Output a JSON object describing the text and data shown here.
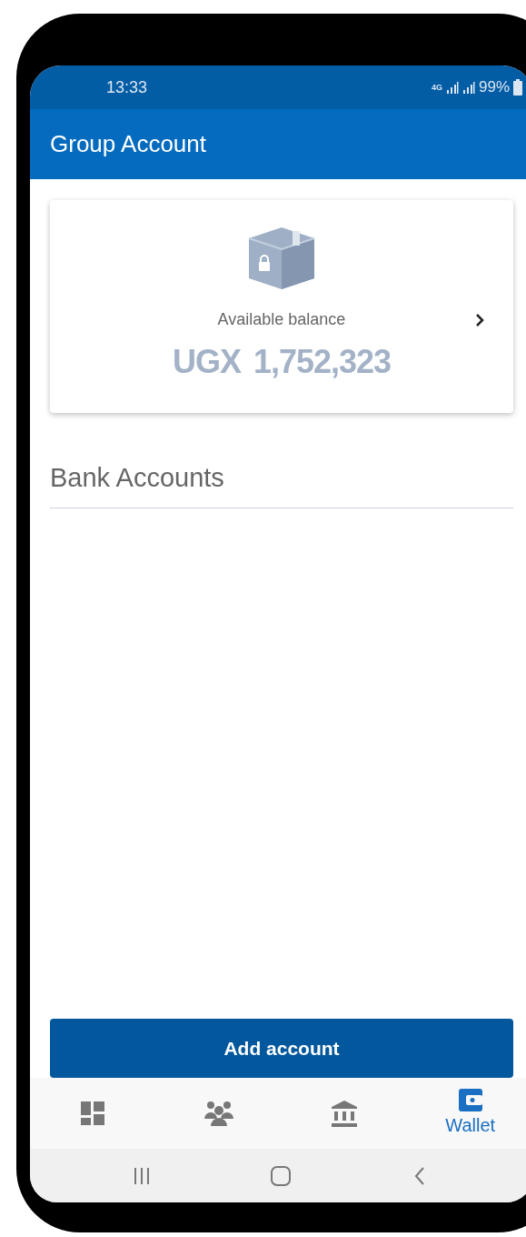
{
  "status_bar": {
    "time": "13:33",
    "network": "4G",
    "battery": "99%"
  },
  "app_bar": {
    "title": "Group Account"
  },
  "balance_card": {
    "label": "Available balance",
    "currency": "UGX",
    "amount": "1,752,323"
  },
  "section": {
    "title": "Bank Accounts"
  },
  "button": {
    "label": "Add account"
  },
  "bottom_nav": [
    {
      "kind": "dashboard",
      "selected": false
    },
    {
      "kind": "group",
      "selected": false
    },
    {
      "kind": "bank",
      "selected": false
    },
    {
      "kind": "wallet",
      "label": "Wallet",
      "selected": true
    }
  ]
}
